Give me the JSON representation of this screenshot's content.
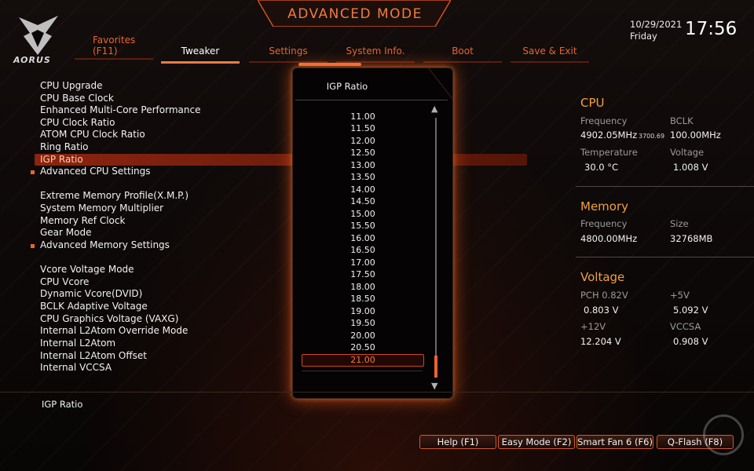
{
  "header": {
    "title": "ADVANCED MODE",
    "logo_text": "AORUS",
    "date": "10/29/2021",
    "day": "Friday",
    "time": "17:56",
    "favorites_line1": "Favorites",
    "favorites_line2": "(F11)",
    "tabs": [
      "Tweaker",
      "Settings",
      "System Info.",
      "Boot",
      "Save & Exit"
    ],
    "active_tab": "Tweaker"
  },
  "menu": {
    "items": [
      "CPU Upgrade",
      "CPU Base Clock",
      "Enhanced Multi-Core Performance",
      "CPU Clock Ratio",
      "ATOM CPU Clock Ratio",
      "Ring Ratio",
      "IGP Ratio",
      "Advanced CPU Settings",
      "Extreme Memory Profile(X.M.P.)",
      "System Memory Multiplier",
      "Memory Ref Clock",
      "Gear Mode",
      "Advanced Memory Settings",
      "Vcore Voltage Mode",
      "CPU Vcore",
      "Dynamic Vcore(DVID)",
      "BCLK Adaptive Voltage",
      "CPU Graphics Voltage (VAXG)",
      "Internal L2Atom Override Mode",
      "Internal L2Atom",
      "Internal L2Atom Offset",
      "Internal VCCSA"
    ],
    "selected": "IGP Ratio"
  },
  "popup": {
    "title": "IGP Ratio",
    "options": [
      "11.00",
      "11.50",
      "12.00",
      "12.50",
      "13.00",
      "13.50",
      "14.00",
      "14.50",
      "15.00",
      "15.50",
      "16.00",
      "16.50",
      "17.00",
      "17.50",
      "18.00",
      "18.50",
      "19.00",
      "19.50",
      "20.00",
      "20.50",
      "21.00"
    ],
    "selected": "21.00"
  },
  "panel": {
    "cpu": {
      "title": "CPU",
      "frequency_label": "Frequency",
      "frequency_value": "4902.05MHz",
      "frequency_sub": "3700.69",
      "bclk_label": "BCLK",
      "bclk_value": "100.00MHz",
      "temperature_label": "Temperature",
      "temperature_value": "30.0 °C",
      "voltage_label": "Voltage",
      "voltage_value": "1.008 V"
    },
    "memory": {
      "title": "Memory",
      "frequency_label": "Frequency",
      "frequency_value": "4800.00MHz",
      "size_label": "Size",
      "size_value": "32768MB"
    },
    "voltage": {
      "title": "Voltage",
      "pch_label": "PCH 0.82V",
      "pch_value": "0.803 V",
      "v5_label": "+5V",
      "v5_value": "5.092 V",
      "v12_label": "+12V",
      "v12_value": "12.204 V",
      "vccsa_label": "VCCSA",
      "vccsa_value": "0.908 V"
    }
  },
  "footer": {
    "help_text": "IGP Ratio",
    "buttons": [
      "Help (F1)",
      "Easy Mode (F2)",
      "Smart Fan 6 (F6)",
      "Q-Flash (F8)"
    ]
  },
  "colors": {
    "accent": "#e8652e",
    "highlight_bar": "#8c2410",
    "section_title": "#f0a040"
  }
}
